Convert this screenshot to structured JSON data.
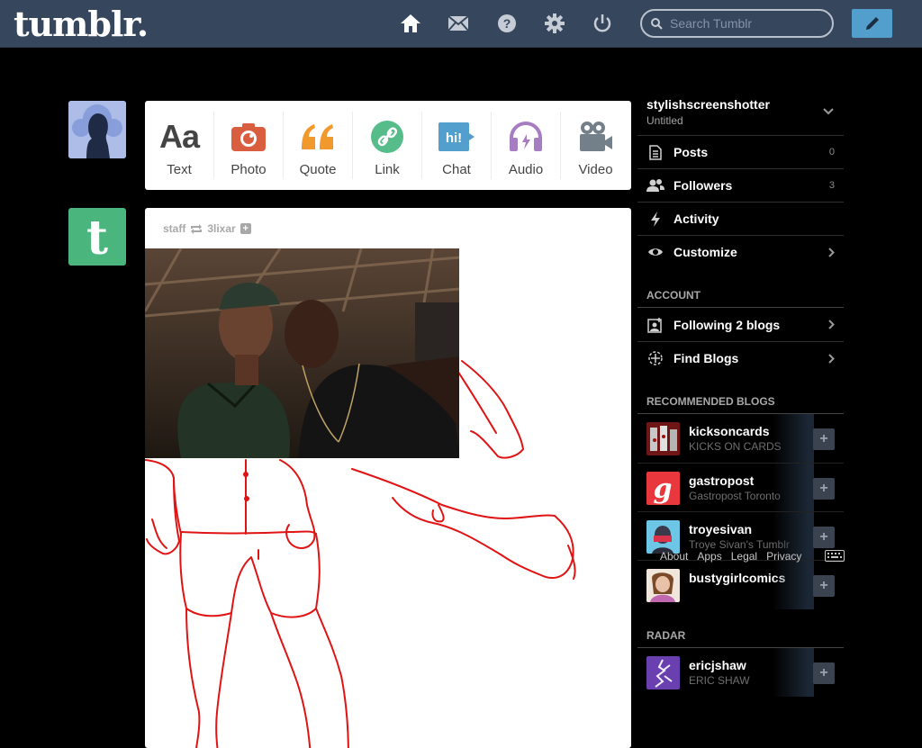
{
  "header": {
    "logo": "tumblr.",
    "search_placeholder": "Search Tumblr"
  },
  "post_types": [
    {
      "label": "Text",
      "icon": "text-icon",
      "color": "#444444"
    },
    {
      "label": "Photo",
      "icon": "camera-icon",
      "color": "#d95e40"
    },
    {
      "label": "Quote",
      "icon": "quote-icon",
      "color": "#f2992e"
    },
    {
      "label": "Link",
      "icon": "link-icon",
      "color": "#56bc8a"
    },
    {
      "label": "Chat",
      "icon": "chat-icon",
      "color": "#529ecc"
    },
    {
      "label": "Audio",
      "icon": "headphones-icon",
      "color": "#a77dc2"
    },
    {
      "label": "Video",
      "icon": "video-camera-icon",
      "color": "#748089"
    }
  ],
  "post": {
    "author": "staff",
    "reblogged_from": "3lixar"
  },
  "sidebar": {
    "blog_name": "stylishscreenshotter",
    "blog_title": "Untitled",
    "rows": [
      {
        "label": "Posts",
        "count": "0"
      },
      {
        "label": "Followers",
        "count": "3"
      },
      {
        "label": "Activity"
      },
      {
        "label": "Customize"
      }
    ],
    "account_title": "ACCOUNT",
    "account_rows": [
      {
        "label": "Following 2 blogs"
      },
      {
        "label": "Find Blogs"
      }
    ],
    "recommended_title": "RECOMMENDED BLOGS",
    "recommended": [
      {
        "name": "kicksoncards",
        "title": "KICKS ON CARDS",
        "avatar_color": "#7a1a1a"
      },
      {
        "name": "gastropost",
        "title": "Gastropost Toronto",
        "avatar_color": "#e8383d"
      },
      {
        "name": "troyesivan",
        "title": "Troye Sivan's Tumblr",
        "avatar_color": "#6ec6e6"
      },
      {
        "name": "bustygirlcomics",
        "title": "",
        "avatar_color": "#d9b8a0"
      }
    ],
    "radar_title": "RADAR",
    "radar": [
      {
        "name": "ericjshaw",
        "title": "ERIC SHAW",
        "avatar_color": "#6a3fb0"
      }
    ],
    "footer": [
      "About",
      "Apps",
      "Legal",
      "Privacy"
    ]
  },
  "colors": {
    "header_bg": "#36465d",
    "accent": "#529ecc",
    "staff_avatar": "#4bb57e"
  }
}
